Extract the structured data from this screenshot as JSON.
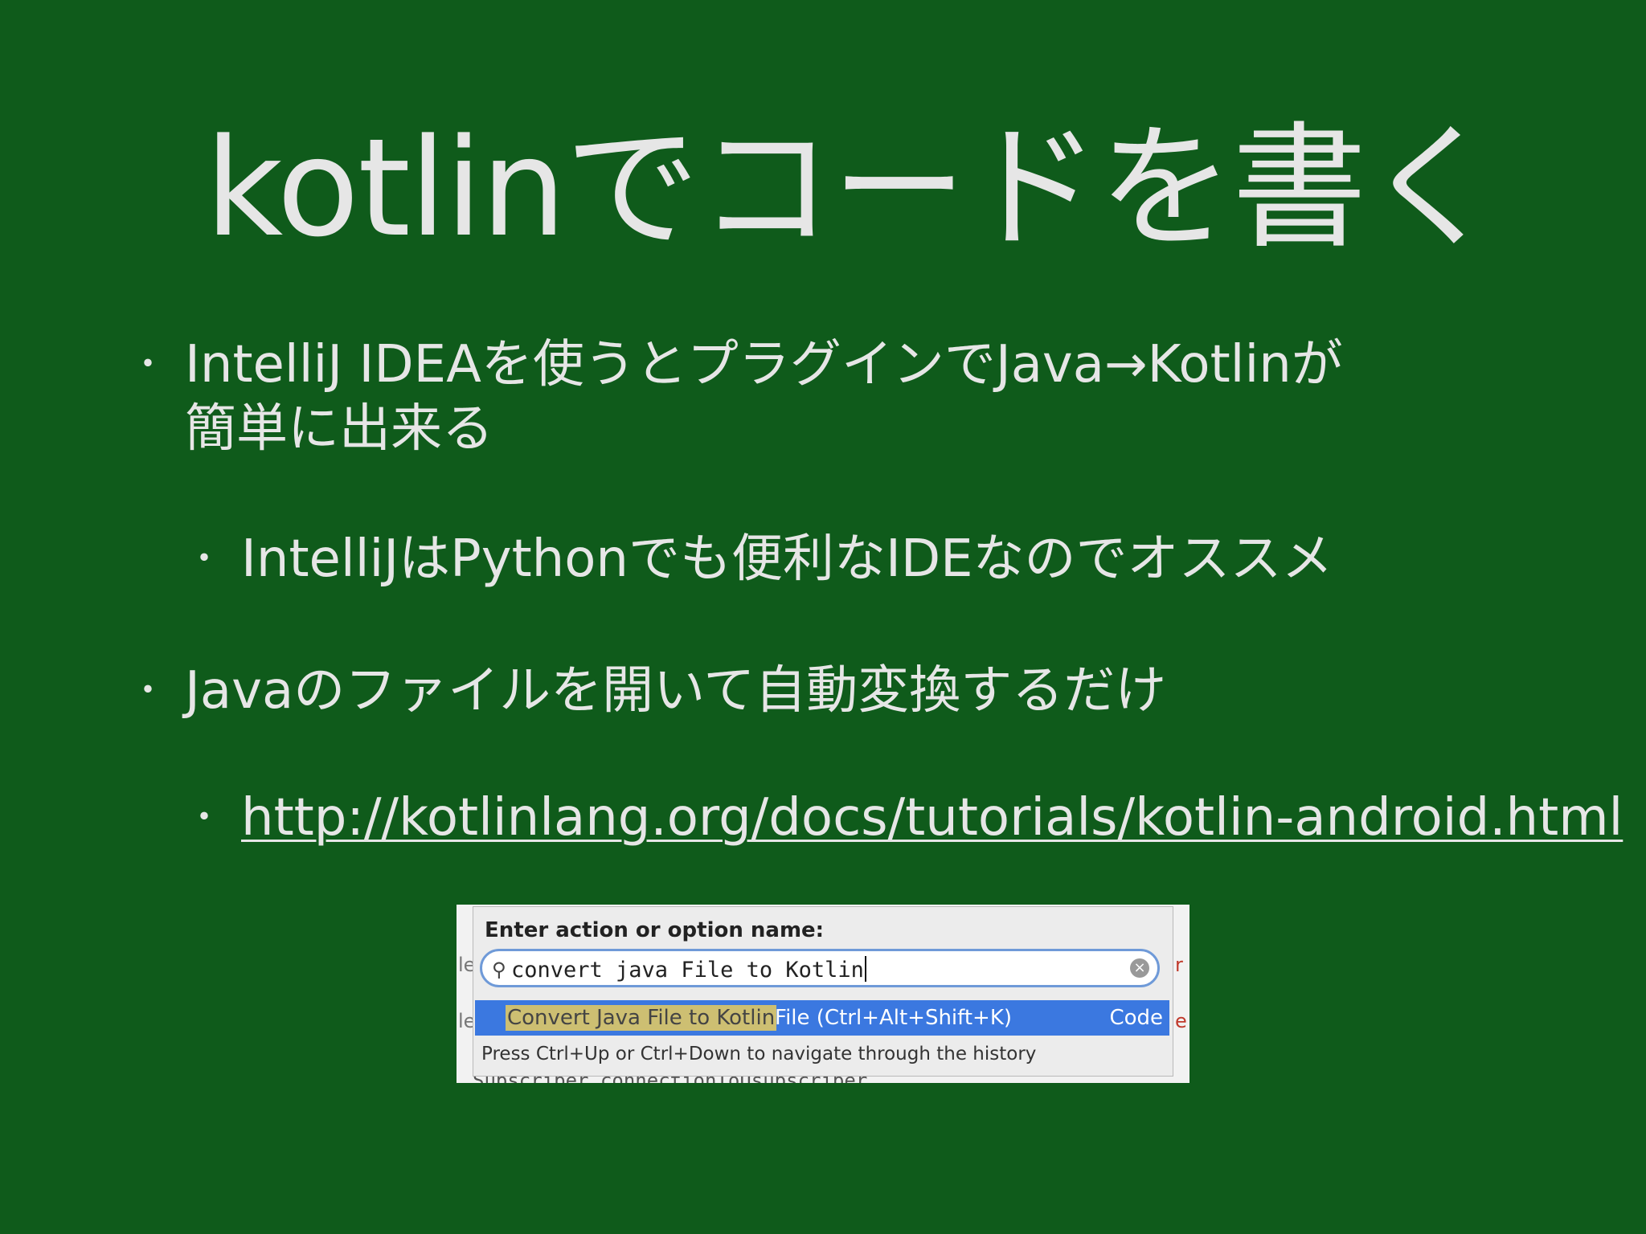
{
  "slide": {
    "title": "kotlinでコードを書く",
    "bullets": [
      {
        "text": "IntelliJ IDEAを使うとプラグインでJava→Kotlinが",
        "text2": "簡単に出来る"
      },
      {
        "text": "IntelliJはPythonでも便利なIDEなのでオススメ"
      },
      {
        "text": "Javaのファイルを開いて自動変換するだけ"
      },
      {
        "text": "http://kotlinlang.org/docs/tutorials/kotlin-android.html"
      }
    ],
    "bullet_glyph": "・"
  },
  "screenshot": {
    "prompt": "Enter action or option name:",
    "search_value": "convert  java File to Kotlin",
    "result_highlight": "Convert Java File to Kotlin",
    "result_rest": "File (Ctrl+Alt+Shift+K)",
    "result_group": "Code",
    "hint": "Press Ctrl+Up or Ctrl+Down to navigate through the history"
  }
}
